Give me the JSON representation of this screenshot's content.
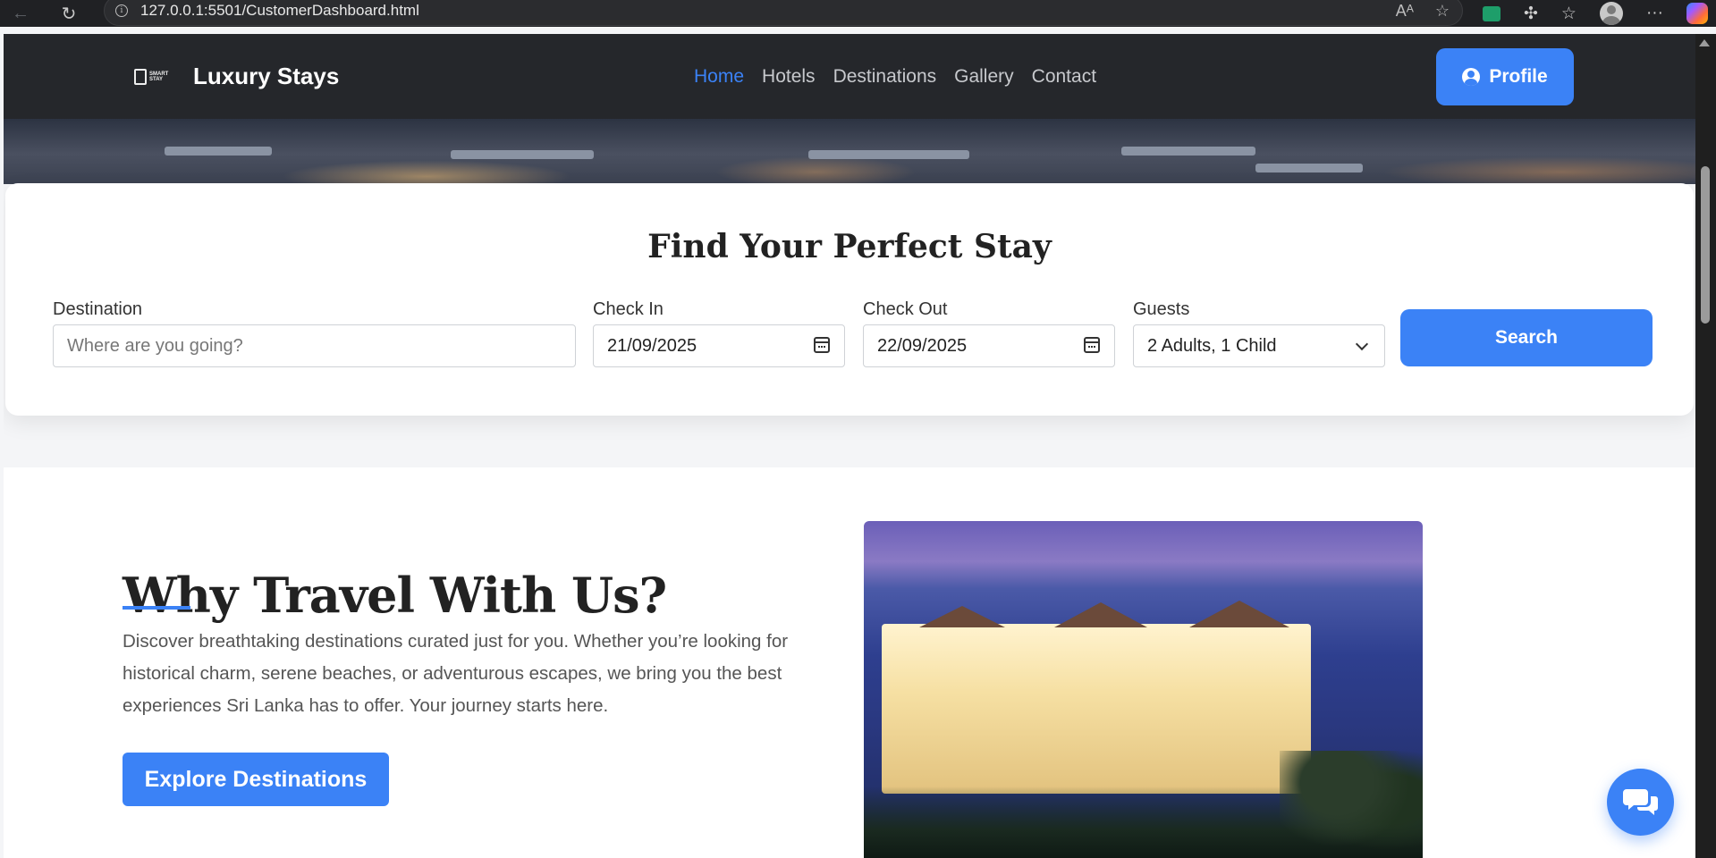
{
  "browser": {
    "url": "127.0.0.1:5501/CustomerDashboard.html",
    "read_aloud_icon": "read-aloud-icon",
    "favorite_icon": "star-icon"
  },
  "navbar": {
    "logo_text_line1": "SMART",
    "logo_text_line2": "STAY",
    "brand": "Luxury Stays",
    "links": [
      {
        "label": "Home",
        "active": true
      },
      {
        "label": "Hotels",
        "active": false
      },
      {
        "label": "Destinations",
        "active": false
      },
      {
        "label": "Gallery",
        "active": false
      },
      {
        "label": "Contact",
        "active": false
      }
    ],
    "profile_label": "Profile"
  },
  "search": {
    "title": "Find Your Perfect Stay",
    "destination_label": "Destination",
    "destination_placeholder": "Where are you going?",
    "checkin_label": "Check In",
    "checkin_value": "21/09/2025",
    "checkout_label": "Check Out",
    "checkout_value": "22/09/2025",
    "guests_label": "Guests",
    "guests_value": "2 Adults, 1 Child",
    "search_button": "Search"
  },
  "why": {
    "title": "Why Travel With Us?",
    "text": "Discover breathtaking destinations curated just for you. Whether you’re looking for historical charm, serene beaches, or adventurous escapes, we bring you the best experiences Sri Lanka has to offer. Your journey starts here.",
    "explore_button": "Explore Destinations"
  },
  "colors": {
    "accent": "#3b82f6",
    "navbar_bg": "#25272b",
    "page_bg": "#f4f5f7"
  }
}
